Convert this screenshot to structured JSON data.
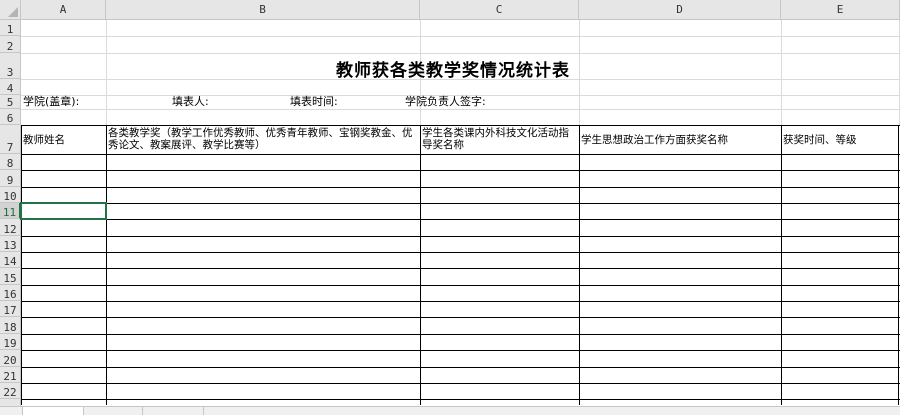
{
  "columns": [
    "A",
    "B",
    "C",
    "D",
    "E"
  ],
  "rows": [
    "1",
    "2",
    "3",
    "4",
    "5",
    "6",
    "7",
    "8",
    "9",
    "10",
    "11",
    "12",
    "13",
    "14",
    "15",
    "16",
    "17",
    "18",
    "19",
    "20",
    "21",
    "22"
  ],
  "active_row": "11",
  "title": "教师获各类教学奖情况统计表",
  "row5": {
    "college": "学院(盖章):",
    "filler": "填表人:",
    "fill_time": "填表时间:",
    "leader_sign": "学院负责人签字:"
  },
  "table_headers": {
    "a": "教师姓名",
    "b": "各类教学奖（教学工作优秀教师、优秀青年教师、宝钢奖教金、优秀论文、教案展评、教学比赛等）",
    "c": "学生各类课内外科技文化活动指导奖名称",
    "d": "学生思想政治工作方面获奖名称",
    "e": "获奖时间、等级"
  },
  "colors": {
    "header_bg": "#e6e6e6",
    "grid": "#dadada",
    "selection": "#217346"
  }
}
